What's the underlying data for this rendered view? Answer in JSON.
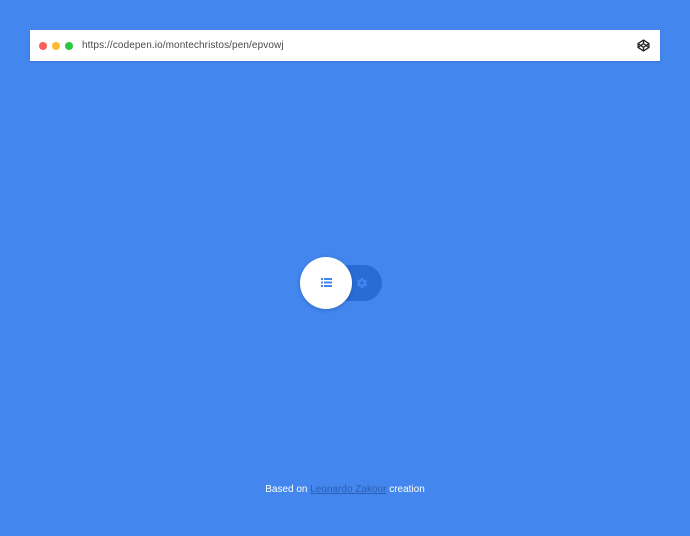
{
  "browser": {
    "url": "https://codepen.io/montechristos/pen/epvowj",
    "traffic_lights": {
      "close": "#fc5f57",
      "minimize": "#fdbc2e",
      "maximize": "#28c840"
    },
    "right_icon": "codepen-icon"
  },
  "toggle": {
    "active_icon": "list-icon",
    "inactive_icon": "gear-icon",
    "state": "list",
    "track_color": "#2a6cd6",
    "knob_color": "#ffffff"
  },
  "footer": {
    "prefix": "Based on",
    "author": "Leonardo Zakour",
    "suffix": "creation"
  },
  "colors": {
    "background": "#4286ee",
    "icon_accent": "#4286ee"
  }
}
